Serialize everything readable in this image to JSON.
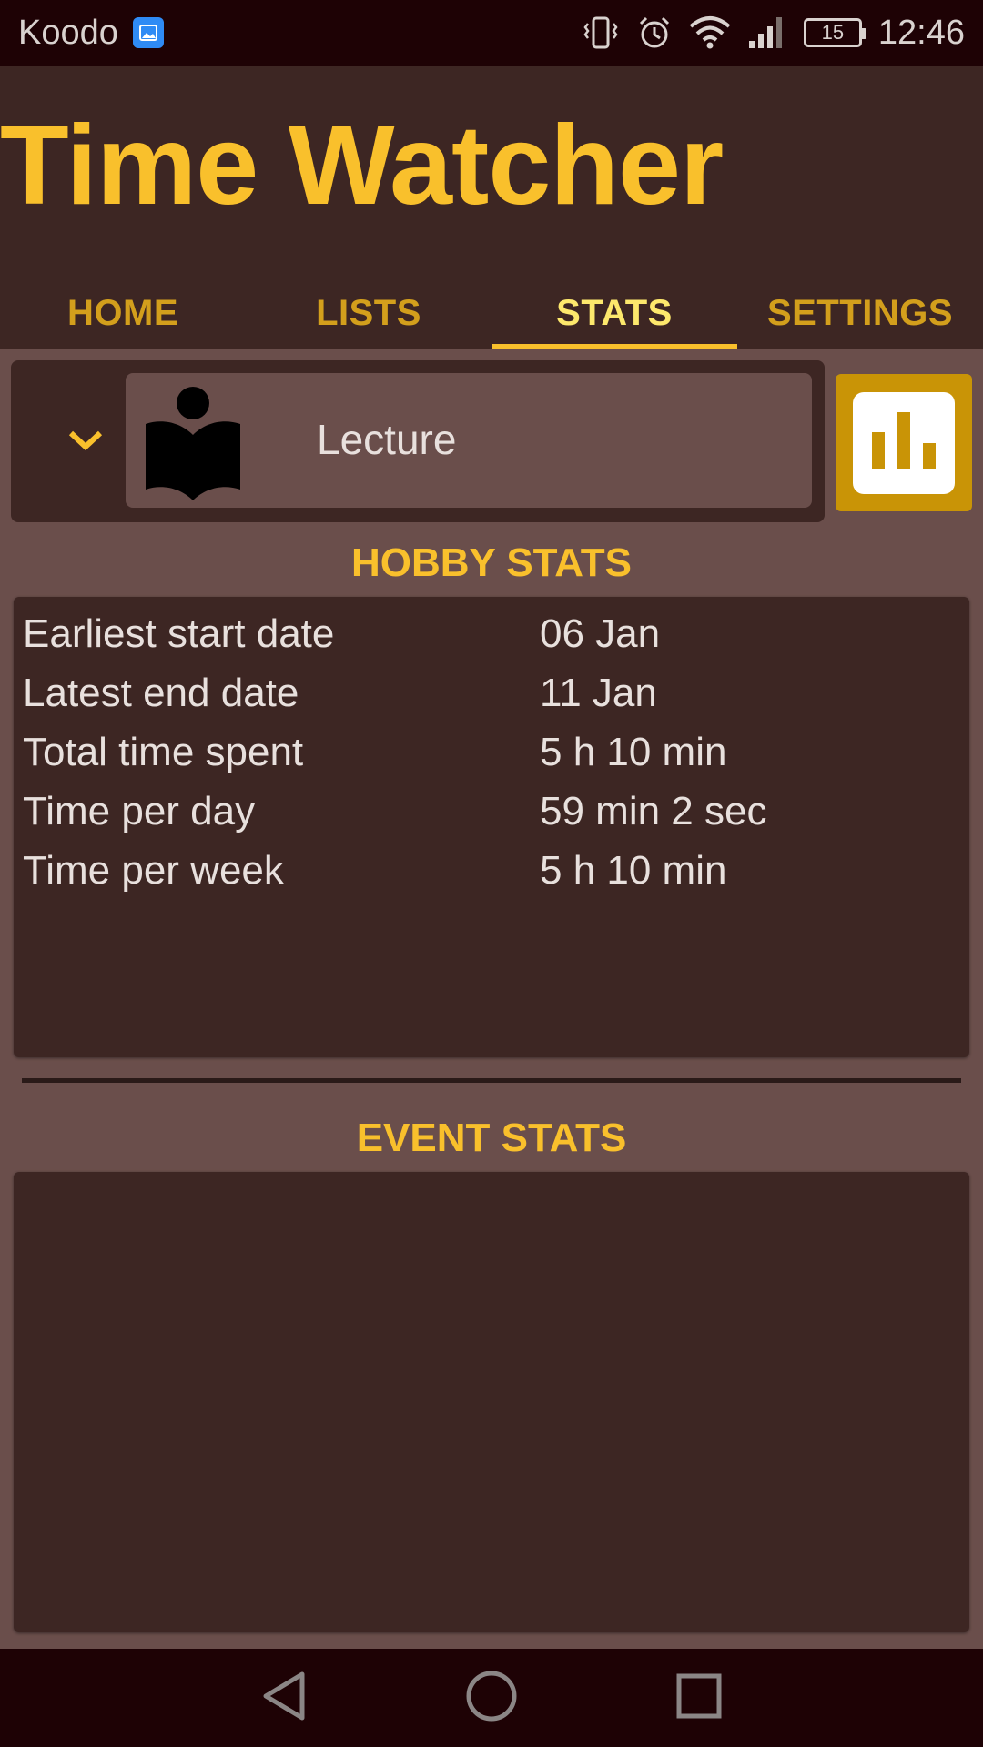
{
  "status_bar": {
    "carrier": "Koodo",
    "battery": "15",
    "time": "12:46"
  },
  "app": {
    "title": "Time Watcher"
  },
  "tabs": [
    {
      "label": "HOME",
      "active": false
    },
    {
      "label": "LISTS",
      "active": false
    },
    {
      "label": "STATS",
      "active": true
    },
    {
      "label": "SETTINGS",
      "active": false
    }
  ],
  "selector": {
    "hobby_name": "Lecture",
    "icon": "book-reader-icon"
  },
  "hobby_stats": {
    "title": "HOBBY STATS",
    "rows": [
      {
        "label": "Earliest start date",
        "value": "06 Jan"
      },
      {
        "label": "Latest end date",
        "value": "11 Jan"
      },
      {
        "label": "Total time spent",
        "value": "5 h 10 min"
      },
      {
        "label": "Time per day",
        "value": "59 min 2 sec"
      },
      {
        "label": "Time per week",
        "value": "5 h 10 min"
      }
    ]
  },
  "event_stats": {
    "title": "EVENT STATS"
  },
  "colors": {
    "accent": "#f9c02c",
    "background": "#6a4e4b",
    "panel": "#3d2623",
    "status_bar": "#1e0205"
  }
}
